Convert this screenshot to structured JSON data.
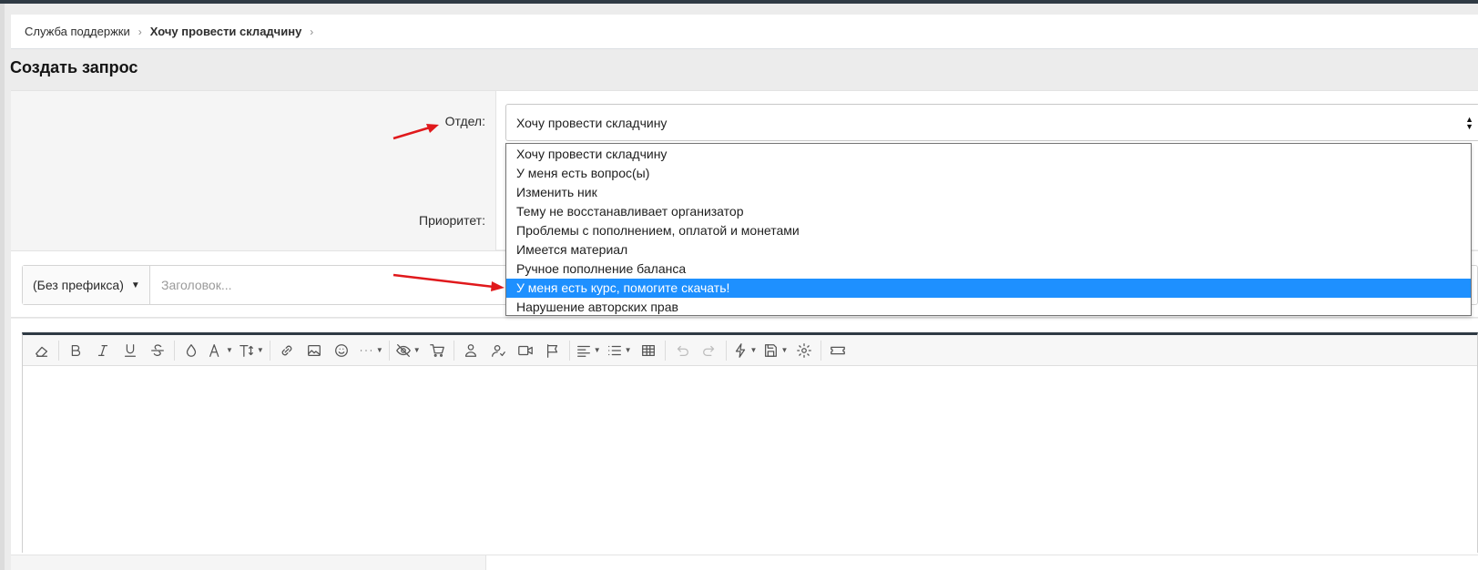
{
  "breadcrumb": [
    {
      "label": "Служба поддержки",
      "current": false
    },
    {
      "label": "Хочу провести складчину",
      "current": true
    }
  ],
  "breadcrumb_separator": "›",
  "page_title": "Создать запрос",
  "form": {
    "department_label": "Отдел:",
    "priority_label": "Приоритет:",
    "department_value": "Хочу провести складчину"
  },
  "dropdown": {
    "options": [
      "Хочу провести складчину",
      "У меня есть вопрос(ы)",
      "Изменить ник",
      "Тему не восстанавливает организатор",
      "Проблемы с пополнением, оплатой и монетами",
      "Имеется материал",
      "Ручное пополнение баланса",
      "У меня есть курс, помогите скачать!",
      "Нарушение авторских прав"
    ],
    "highlighted": "У меня есть курс, помогите скачать!",
    "highlight_color": "#1e90ff"
  },
  "title_row": {
    "prefix_label": "(Без префикса)",
    "title_placeholder": "Заголовок..."
  },
  "toolbar_icons": [
    "eraser-icon",
    "bold-icon",
    "italic-icon",
    "underline-icon",
    "strikethrough-icon",
    "color-icon",
    "font-family-icon",
    "font-size-icon",
    "link-icon",
    "image-icon",
    "smilie-icon",
    "more-icon",
    "hide-icon",
    "cart-icon",
    "user-badge-icon",
    "user-icon",
    "video-icon",
    "flag-icon",
    "align-icon",
    "list-icon",
    "table-icon",
    "undo-icon",
    "redo-icon",
    "bolt-icon",
    "draft-icon",
    "settings-icon",
    "ticket-icon"
  ],
  "colors": {
    "topbar": "#2f3a44",
    "annotation_arrow": "#e0191c"
  }
}
